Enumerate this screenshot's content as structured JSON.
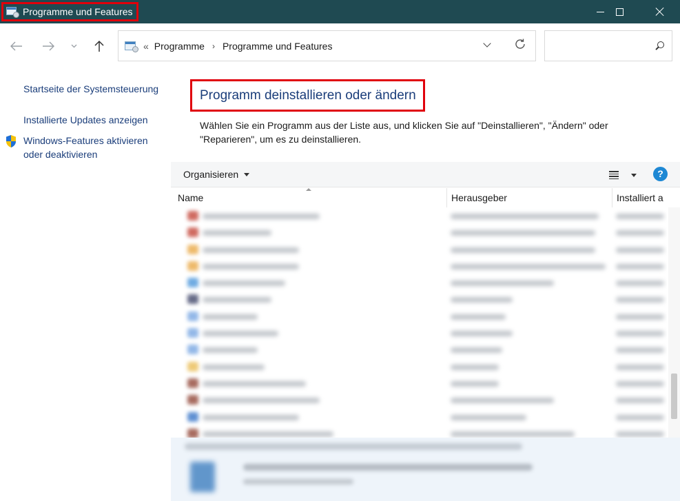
{
  "window": {
    "title": "Programme und Features"
  },
  "address": {
    "overflow_marker": "«",
    "crumbs": [
      "Programme",
      "Programme und Features"
    ],
    "crumb_arrow": "›"
  },
  "search": {
    "value": "",
    "placeholder": ""
  },
  "sidebar": {
    "links": [
      "Startseite der Systemsteuerung",
      "Installierte Updates anzeigen",
      "Windows-Features aktivieren oder deaktivieren"
    ]
  },
  "main": {
    "heading": "Programm deinstallieren oder ändern",
    "description": "Wählen Sie ein Programm aus der Liste aus, und klicken Sie auf \"Deinstallieren\", \"Ändern\" oder \"Reparieren\", um es zu deinstallieren."
  },
  "toolbar": {
    "organize_label": "Organisieren",
    "help_glyph": "?"
  },
  "columns": {
    "name": "Name",
    "publisher": "Herausgeber",
    "installed": "Installiert a"
  },
  "colors": {
    "titlebar": "#1f4a52",
    "highlight_border": "#e0000b",
    "link": "#1a3d7a",
    "help": "#1e88d4"
  }
}
